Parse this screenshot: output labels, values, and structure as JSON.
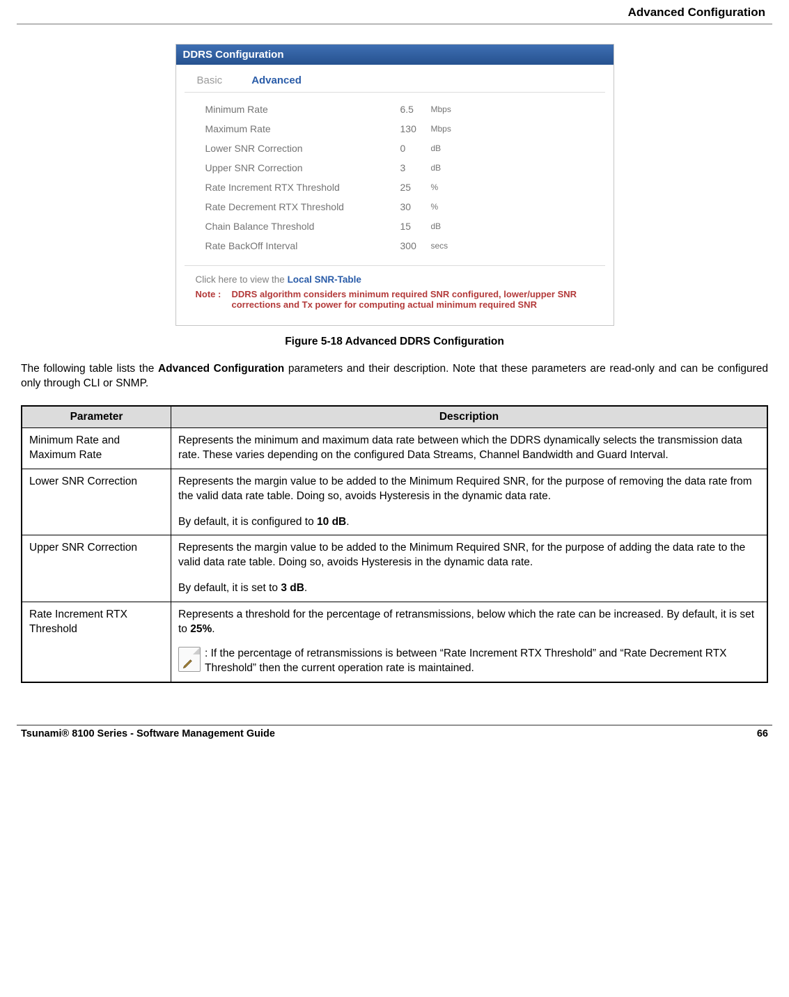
{
  "header": {
    "section_title": "Advanced Configuration"
  },
  "panel": {
    "title": "DDRS Configuration",
    "tabs": {
      "basic": "Basic",
      "advanced": "Advanced"
    },
    "rows": [
      {
        "label": "Minimum Rate",
        "value": "6.5",
        "unit": "Mbps"
      },
      {
        "label": "Maximum Rate",
        "value": "130",
        "unit": "Mbps"
      },
      {
        "label": "Lower SNR Correction",
        "value": "0",
        "unit": "dB"
      },
      {
        "label": "Upper SNR Correction",
        "value": "3",
        "unit": "dB"
      },
      {
        "label": "Rate Increment RTX Threshold",
        "value": "25",
        "unit": "%"
      },
      {
        "label": "Rate Decrement RTX Threshold",
        "value": "30",
        "unit": "%"
      },
      {
        "label": "Chain Balance Threshold",
        "value": "15",
        "unit": "dB"
      },
      {
        "label": "Rate BackOff Interval",
        "value": "300",
        "unit": "secs"
      }
    ],
    "snr_link_prefix": "Click here to view the ",
    "snr_link": "Local SNR-Table",
    "note_label": "Note :",
    "note_text": "DDRS algorithm considers minimum required SNR configured, lower/upper SNR corrections and Tx power for computing actual minimum required SNR"
  },
  "figure_caption": "Figure 5-18 Advanced DDRS Configuration",
  "intro": {
    "prefix": "The following table lists the ",
    "bold": "Advanced Configuration",
    "suffix": " parameters and their description. Note that these parameters are read-only and can be configured only through CLI or SNMP."
  },
  "table": {
    "headers": {
      "param": "Parameter",
      "desc": "Description"
    },
    "rows": [
      {
        "param": "Minimum Rate and Maximum Rate",
        "desc_p1": "Represents the minimum and maximum data rate between which the DDRS dynamically selects the transmission data rate. These varies depending on the configured Data Streams, Channel Bandwidth and Guard Interval."
      },
      {
        "param": "Lower SNR Correction",
        "desc_p1": "Represents the margin value to be added to the Minimum Required SNR, for the purpose of removing the data rate from the valid data rate table. Doing so, avoids Hysteresis in the dynamic data rate.",
        "desc_p2_prefix": "By default, it is configured to ",
        "desc_p2_bold": "10 dB",
        "desc_p2_suffix": "."
      },
      {
        "param": "Upper SNR Correction",
        "desc_p1": "Represents the margin value to be added to the Minimum Required SNR, for the purpose of adding the data rate to the valid data rate table. Doing so, avoids Hysteresis in the dynamic data rate.",
        "desc_p2_prefix": "By default, it is set to ",
        "desc_p2_bold": "3 dB",
        "desc_p2_suffix": "."
      },
      {
        "param": "Rate Increment RTX Threshold",
        "desc_p1_prefix": "Represents a threshold for the percentage of retransmissions, below which the rate can be increased. By default, it is set to ",
        "desc_p1_bold": "25%",
        "desc_p1_suffix": ".",
        "note": ": If the percentage of retransmissions is between “Rate Increment RTX Threshold” and “Rate Decrement RTX Threshold” then the current operation rate is maintained."
      }
    ]
  },
  "footer": {
    "left": "Tsunami® 8100 Series - Software Management Guide",
    "right": "66"
  }
}
